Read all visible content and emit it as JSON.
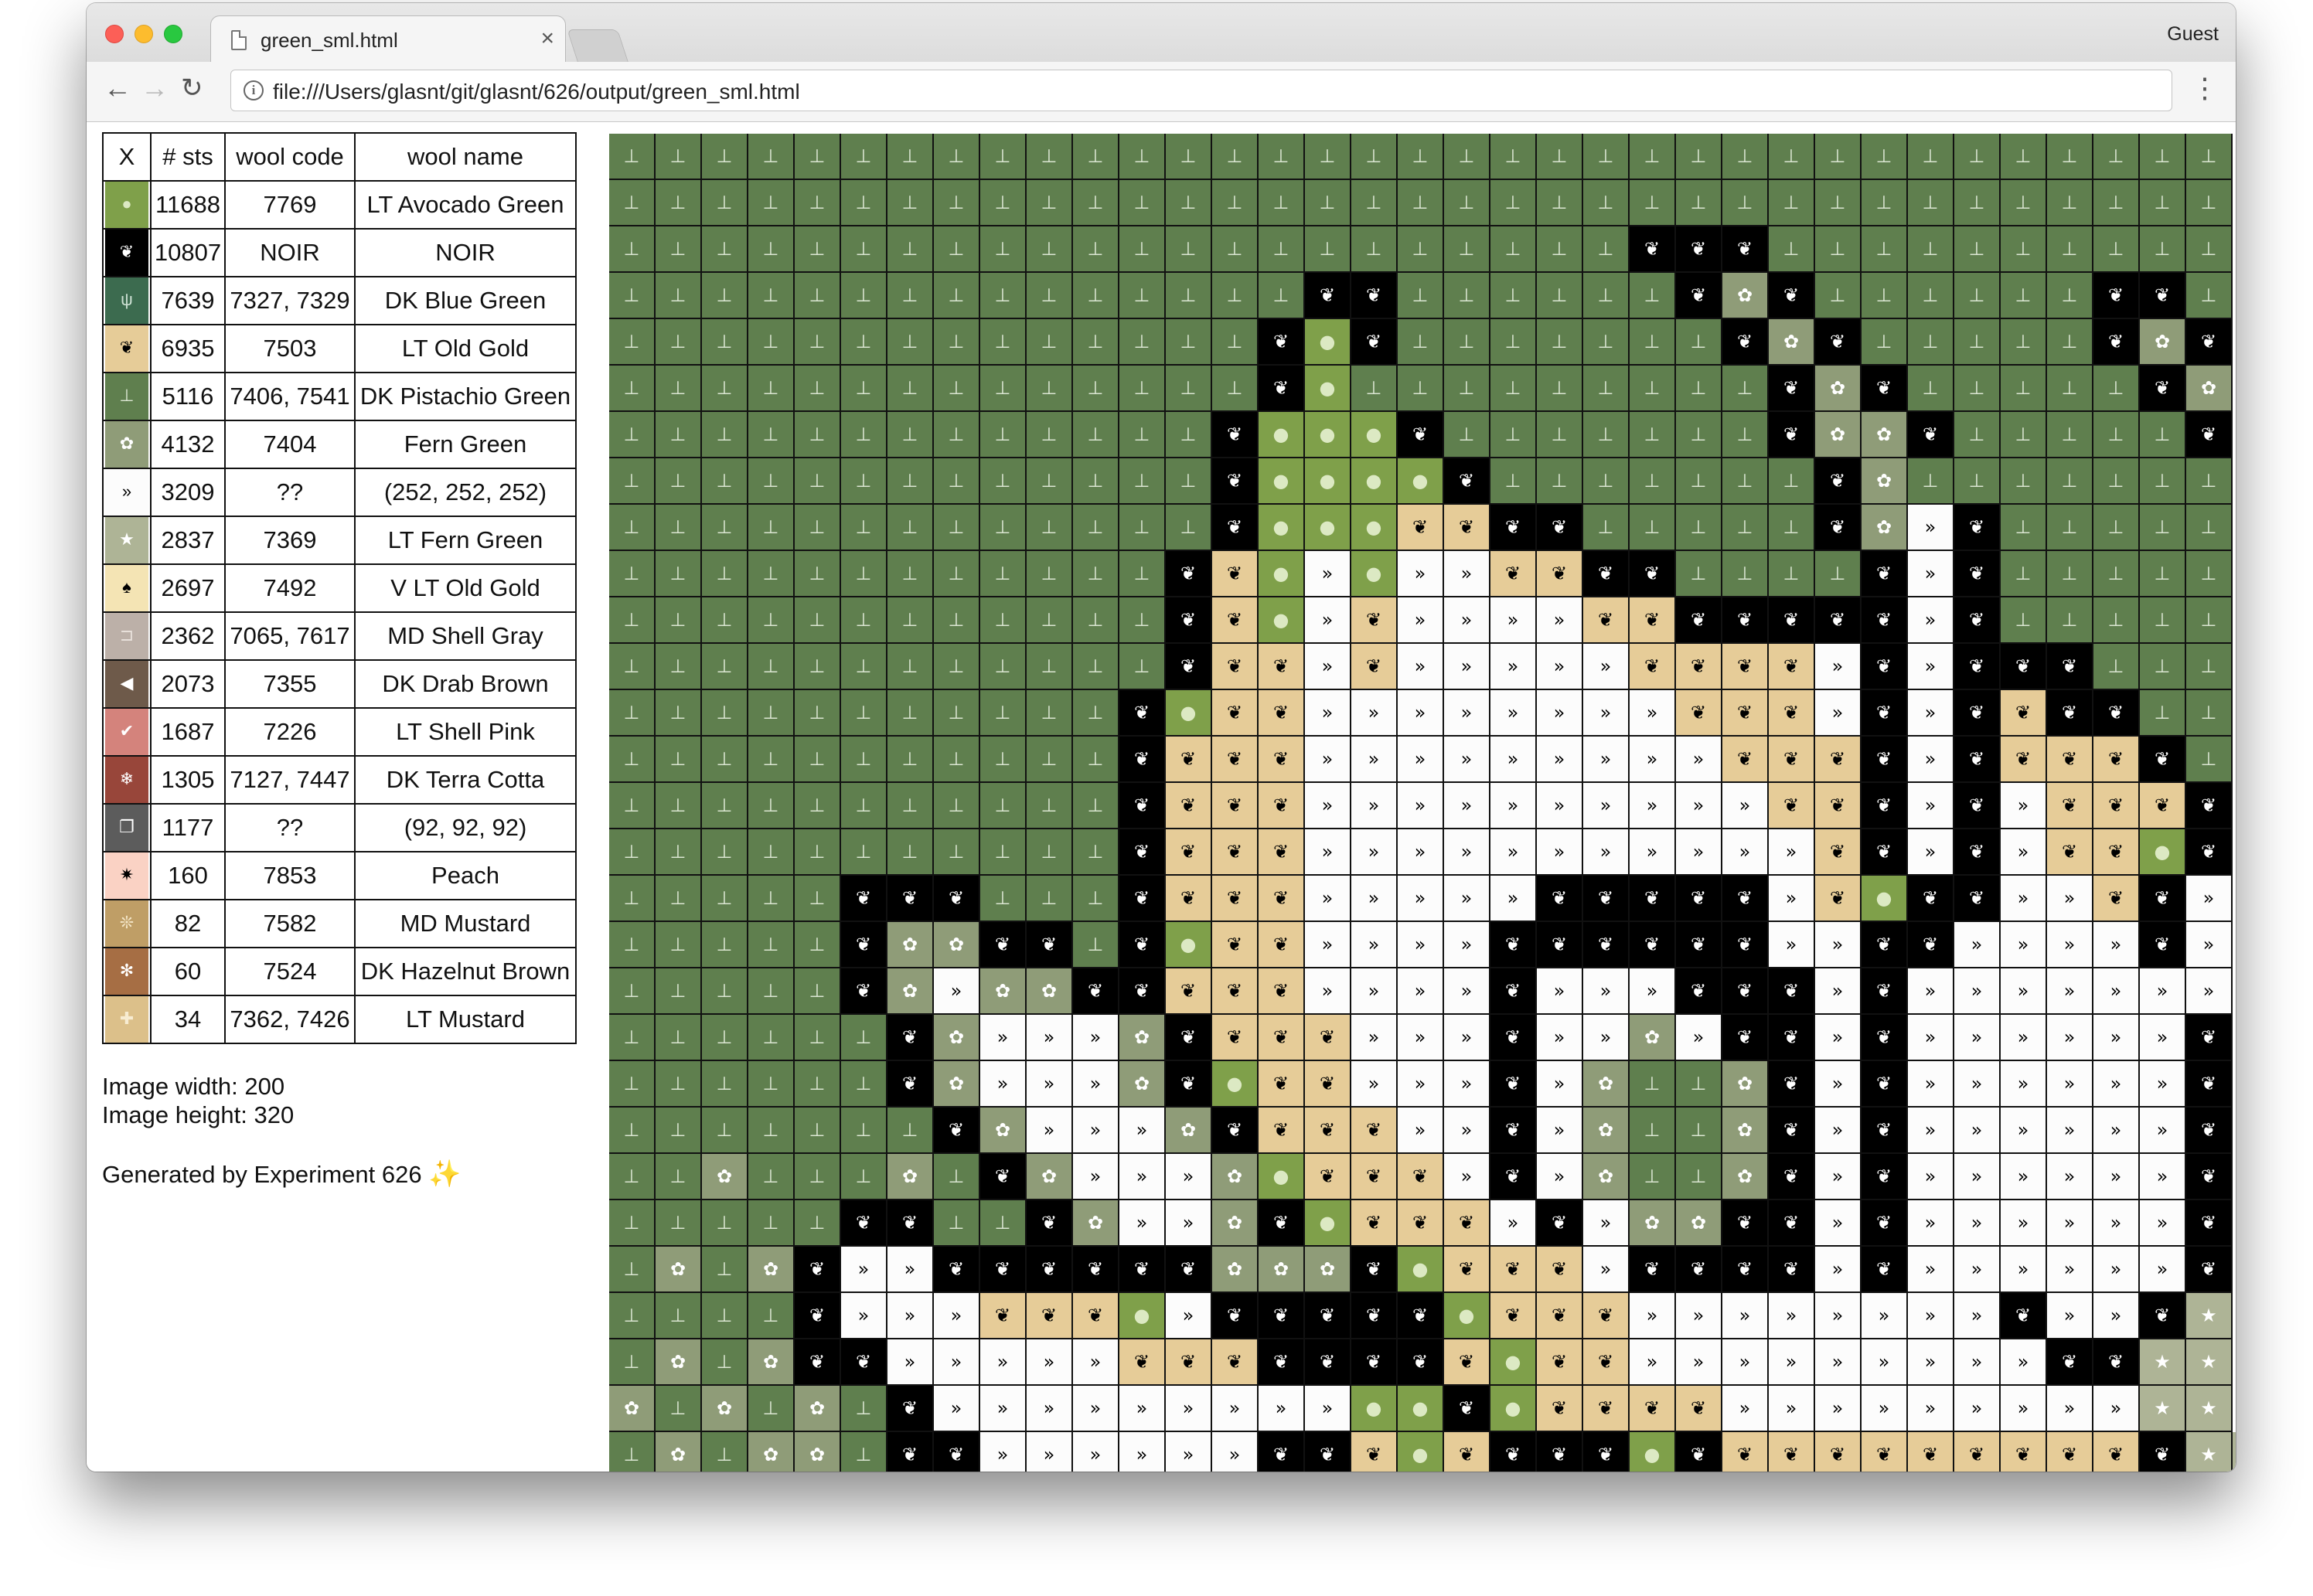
{
  "browser": {
    "tab_title": "green_sml.html",
    "tab_close": "×",
    "profile": "Guest",
    "url": "file:///Users/glasnt/git/glasnt/626/output/green_sml.html",
    "back": "←",
    "forward": "→",
    "reload": "↻",
    "menu": "⋮",
    "info": "i"
  },
  "legend": {
    "headers": [
      "X",
      "# sts",
      "wool code",
      "wool name"
    ],
    "rows": [
      {
        "symbol": "●",
        "color": "#7fa04a",
        "fg": "#dce9c3",
        "sts": "11688",
        "code": "7769",
        "name": "LT Avocado Green"
      },
      {
        "symbol": "❦",
        "color": "#000000",
        "fg": "#ffffff",
        "sts": "10807",
        "code": "NOIR",
        "name": "NOIR"
      },
      {
        "symbol": "ψ",
        "color": "#3c6b4f",
        "fg": "#cde0d3",
        "sts": "7639",
        "code": "7327, 7329",
        "name": "DK Blue Green"
      },
      {
        "symbol": "❦",
        "color": "#e6cc98",
        "fg": "#000000",
        "sts": "6935",
        "code": "7503",
        "name": "LT Old Gold"
      },
      {
        "symbol": "⊥",
        "color": "#5f7f4e",
        "fg": "#dbe6d2",
        "sts": "5116",
        "code": "7406, 7541",
        "name": "DK Pistachio Green"
      },
      {
        "symbol": "✿",
        "color": "#8f9c78",
        "fg": "#ffffff",
        "sts": "4132",
        "code": "7404",
        "name": "Fern Green"
      },
      {
        "symbol": "»",
        "color": "#fcfcfc",
        "fg": "#000000",
        "sts": "3209",
        "code": "??",
        "name": "(252, 252, 252)"
      },
      {
        "symbol": "★",
        "color": "#aeb496",
        "fg": "#ffffff",
        "sts": "2837",
        "code": "7369",
        "name": "LT Fern Green"
      },
      {
        "symbol": "♠",
        "color": "#f4e4b4",
        "fg": "#000000",
        "sts": "2697",
        "code": "7492",
        "name": "V LT Old Gold"
      },
      {
        "symbol": "⊐",
        "color": "#bcb0a8",
        "fg": "#e8e0da",
        "sts": "2362",
        "code": "7065, 7617",
        "name": "MD Shell Gray"
      },
      {
        "symbol": "◀",
        "color": "#6e5a4a",
        "fg": "#ffffff",
        "sts": "2073",
        "code": "7355",
        "name": "DK Drab Brown"
      },
      {
        "symbol": "✔",
        "color": "#d4837c",
        "fg": "#ffffff",
        "sts": "1687",
        "code": "7226",
        "name": "LT Shell Pink"
      },
      {
        "symbol": "❄",
        "color": "#98463a",
        "fg": "#ffffff",
        "sts": "1305",
        "code": "7127, 7447",
        "name": "DK Terra Cotta"
      },
      {
        "symbol": "❐",
        "color": "#5c5c5c",
        "fg": "#ffffff",
        "sts": "1177",
        "code": "??",
        "name": "(92, 92, 92)"
      },
      {
        "symbol": "✷",
        "color": "#fad2c4",
        "fg": "#000000",
        "sts": "160",
        "code": "7853",
        "name": "Peach"
      },
      {
        "symbol": "❊",
        "color": "#bf9e66",
        "fg": "#f4e6c8",
        "sts": "82",
        "code": "7582",
        "name": "MD Mustard"
      },
      {
        "symbol": "✻",
        "color": "#a66e44",
        "fg": "#ffffff",
        "sts": "60",
        "code": "7524",
        "name": "DK Hazelnut Brown"
      },
      {
        "symbol": "✚",
        "color": "#dcc08a",
        "fg": "#f7ecd2",
        "sts": "34",
        "code": "7362, 7426",
        "name": "LT Mustard"
      }
    ]
  },
  "info": {
    "width_line": "Image width: 200",
    "height_line": "Image height: 320",
    "generated": "Generated by Experiment 626",
    "sparkle": "✨"
  },
  "palette": {
    "G": {
      "bg": "#5f7f4e",
      "fg": "#dbe6d2",
      "sym": "⊥"
    },
    "B": {
      "bg": "#000000",
      "fg": "#ffffff",
      "sym": "❦"
    },
    "Y": {
      "bg": "#e6cc98",
      "fg": "#000000",
      "sym": "❦"
    },
    "W": {
      "bg": "#fcfcfc",
      "fg": "#000000",
      "sym": "»"
    },
    "A": {
      "bg": "#7fa04a",
      "fg": "#dce9c3",
      "sym": "●"
    },
    "F": {
      "bg": "#8f9c78",
      "fg": "#ffffff",
      "sym": "✿"
    },
    "L": {
      "bg": "#aeb496",
      "fg": "#ffffff",
      "sym": "★"
    }
  },
  "pattern": [
    "GGGGGGGGGGGGGGGGGGGGGGGGGGGGGGGGGGG",
    "GGGGGGGGGGGGGGGGGGGGGGGGGGGGGGGGGGG",
    "GGGGGGGGGGGGGGGGGGGGGGBBBGGGGGGGGGG",
    "GGGGGGGGGGGGGGGBBGGGGGGBFBGGGGGGBBG",
    "GGGGGGGGGGGGGGBABGGGGGGGBFBGGGGGBFB",
    "GGGGGGGGGGGGGGBAGGGGGGGGGBFBGGGGGBF",
    "GGGGGGGGGGGGGBAAABGGGGGGGBFFBGGGGGB",
    "GGGGGGGGGGGGGBAAAABGGGGGGGBFGGGGGGG",
    "GGGGGGGGGGGGGBAAAYYBBGGGGGBFWBGGGGG",
    "GGGGGGGGGGGGBYAWAWWYYBBGGGGBWBGGGGG",
    "GGGGGGGGGGGGBYAWYWWWWYYBBBBBWBGGGGG",
    "GGGGGGGGGGGGBYYWYWWWWWYYYYWBWBBBGGG",
    "GGGGGGGGGGGBAYYWWWWWWWWYYYWBWBYBBGG",
    "GGGGGGGGGGGBYYYWWWWWWWWWYYYBWBYYYBG",
    "GGGGGGGGGGGBYYYWWWWWWWWWWYYBWBWYYYB",
    "GGGGGGGGGGGBYYYWWWWWWWWWWWYBWBWYYAB",
    "GGGGGBBBGGGBYYYWWWWWBBBBBWYABBWWYBW",
    "GGGGGBFFBBGBAYYWWWWBBBBBBWWBBWWWWBW",
    "GGGGGBFWFFBBYYYWWWWBWWWBBBWBWWWWWWW",
    "GGGGGGBFWWWFBYYYWWWBWWFWBBWBWWWWWWB",
    "GGGGGGBFWWWFBAYYWWWBWFGGFBWBWWWWWWB",
    "GGGGGGGBFWWWFBYYYWWBWFGGFBWBWWWWWWB",
    "GGFGGGFGBFWWWFAYYYWBWFGGFBWBWWWWWWB",
    "GGGGGBBGGBFWWFBAYYYWBWFFBBWBWWWWWWB",
    "GFGFBWWBBBBBBFFFBAYYYWBBBBWBWWWWWWB",
    "GGGGBWWWYYYAWBBBBBAYYYWWWWWWWWBWWBL",
    "GFGFBBWWWWWYYYBBBBYAYYWWWWWWWWWBBLL",
    "FGFGFGBWWWWWWWWWAABAYYYYWWWWWWWWWLL",
    "GFGFFGBBWWWWWWBBYAYBBBABYYYYYYYYYBLL"
  ]
}
